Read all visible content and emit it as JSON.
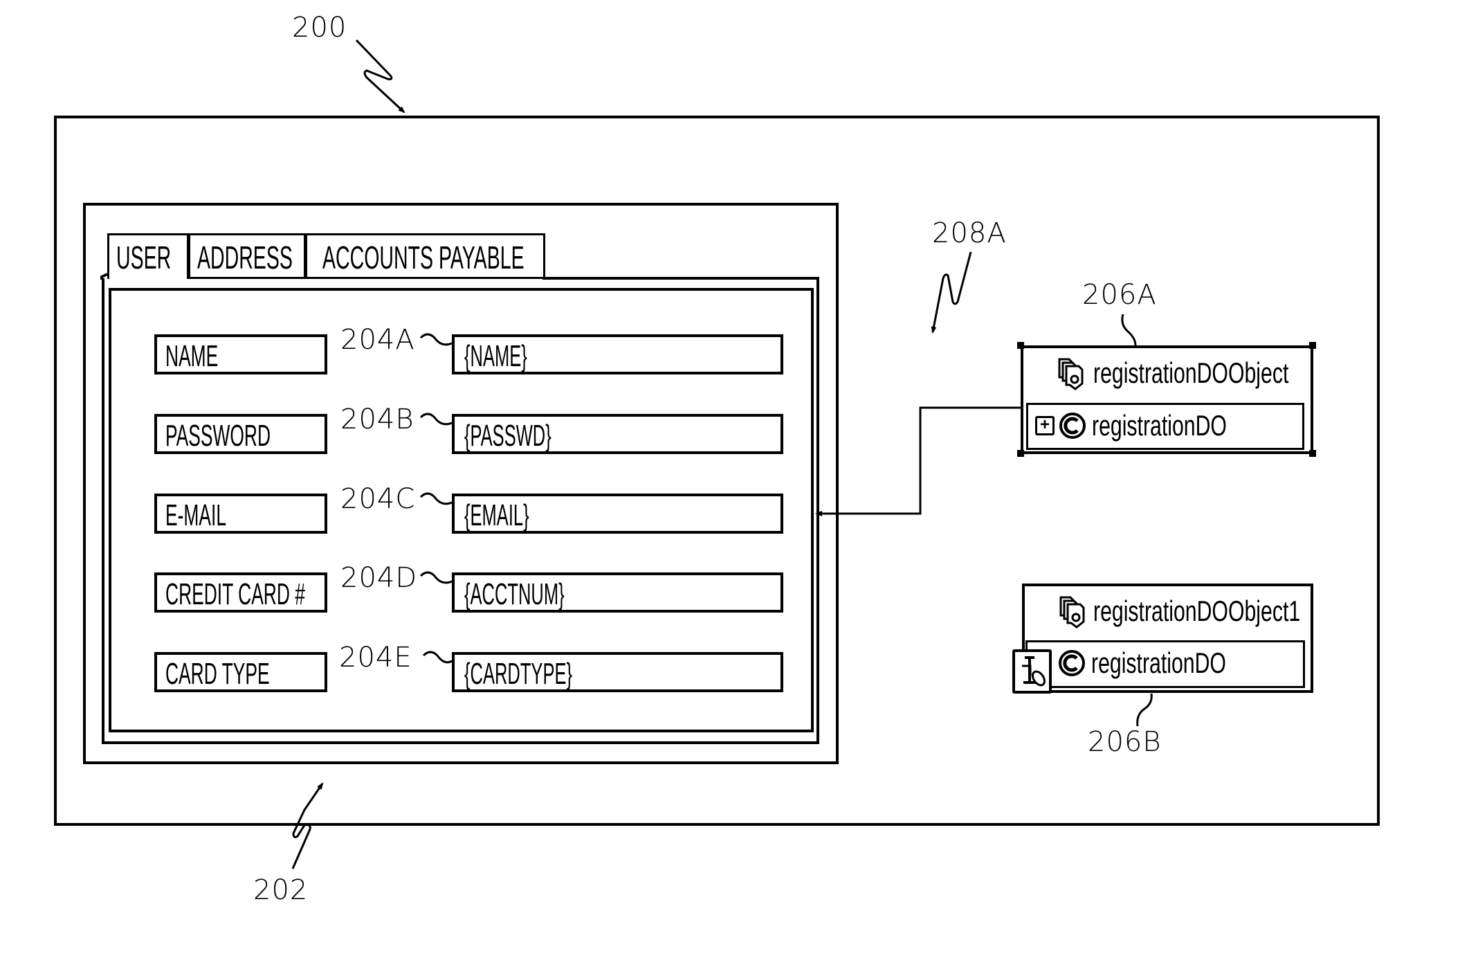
{
  "figure": {
    "window_ref": "200",
    "form_ref": "202",
    "connection_ref": "208A"
  },
  "form": {
    "tabs": [
      {
        "label": "USER",
        "active": true
      },
      {
        "label": "ADDRESS",
        "active": false
      },
      {
        "label": "ACCOUNTS PAYABLE",
        "active": false
      }
    ],
    "rows": [
      {
        "label": "NAME",
        "ref": "204A",
        "value": "{NAME}"
      },
      {
        "label": "PASSWORD",
        "ref": "204B",
        "value": "{PASSWD}"
      },
      {
        "label": "E-MAIL",
        "ref": "204C",
        "value": "{EMAIL}"
      },
      {
        "label": "CREDIT CARD #",
        "ref": "204D",
        "value": "{ACCTNUM}"
      },
      {
        "label": "CARD TYPE",
        "ref": "204E",
        "value": "{CARDTYPE}"
      }
    ]
  },
  "components": [
    {
      "ref": "206A",
      "object_name": "registrationDOObject",
      "class_name": "registrationDO",
      "object_icon": "object-stack-icon",
      "class_icon": "class-c-icon",
      "extra_icon": "expand-plus-icon",
      "selected": true
    },
    {
      "ref": "206B",
      "object_name": "registrationDOObject1",
      "class_name": "registrationDO",
      "object_icon": "object-stack-icon",
      "class_icon": "class-c-icon",
      "extra_icon": "inspector-tool-icon",
      "selected": false
    }
  ]
}
